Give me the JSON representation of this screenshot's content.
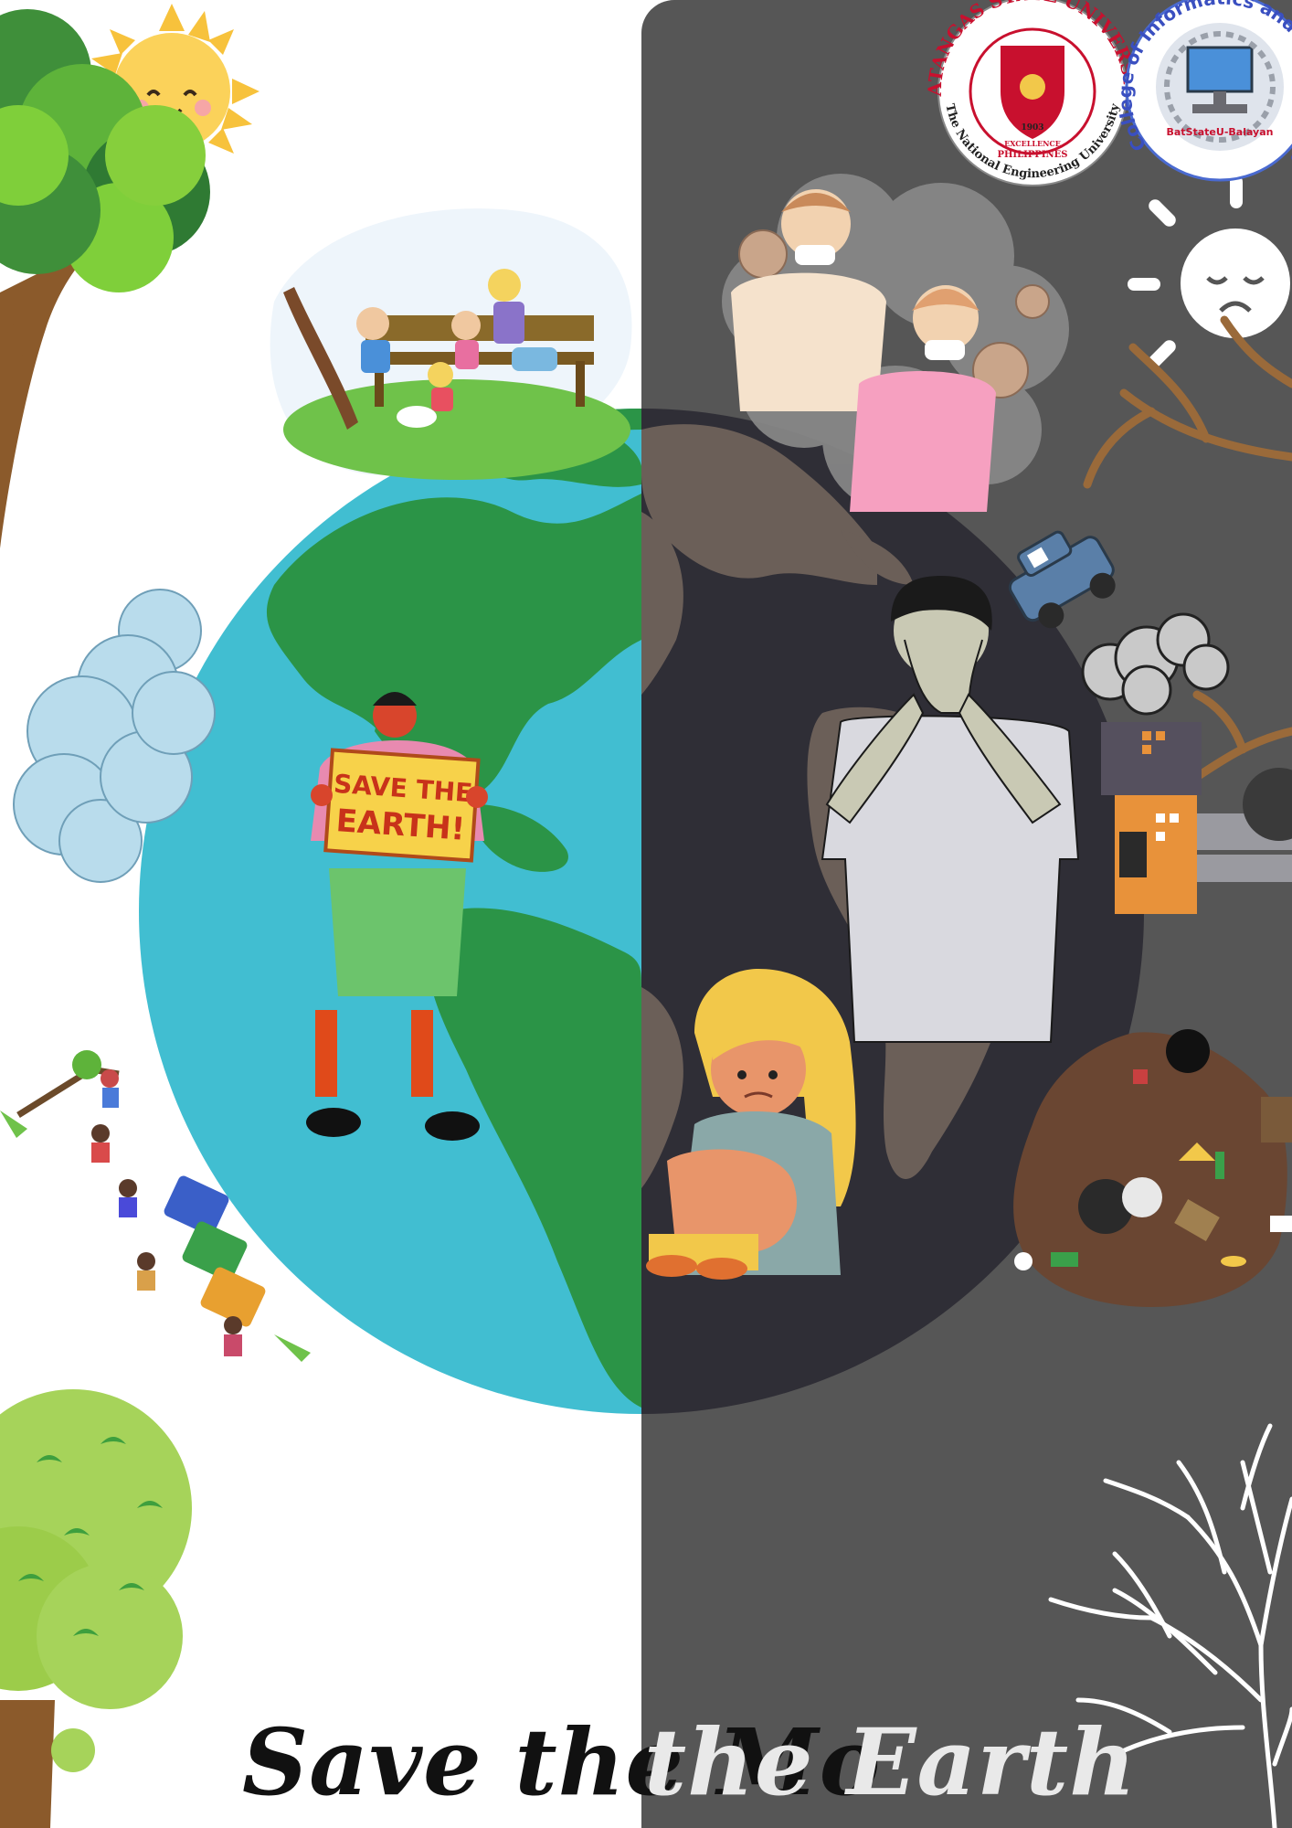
{
  "poster": {
    "title_left": "Save the Mo",
    "title_right": "the Earth",
    "sign_line1": "SAVE THE",
    "sign_line2": "EARTH!"
  },
  "logos": {
    "university": {
      "name": "BATANGAS STATE UNIVERSITY",
      "tagline": "The National Engineering University",
      "country": "PHILIPPINES",
      "year": "1903",
      "ribbon": "EXCELLENCE"
    },
    "college": {
      "name": "College of Informatics and Computing Sciences",
      "campus": "BatStateU-Balayan"
    }
  },
  "colors": {
    "dark_panel": "#565656",
    "ocean": "#41bed1",
    "land": "#2b9447",
    "dark_globe": "#2f2e36",
    "dark_land": "#6b5f58",
    "sun": "#fbd25a",
    "title_dark": "#111111",
    "title_light": "#e9e9e9"
  }
}
